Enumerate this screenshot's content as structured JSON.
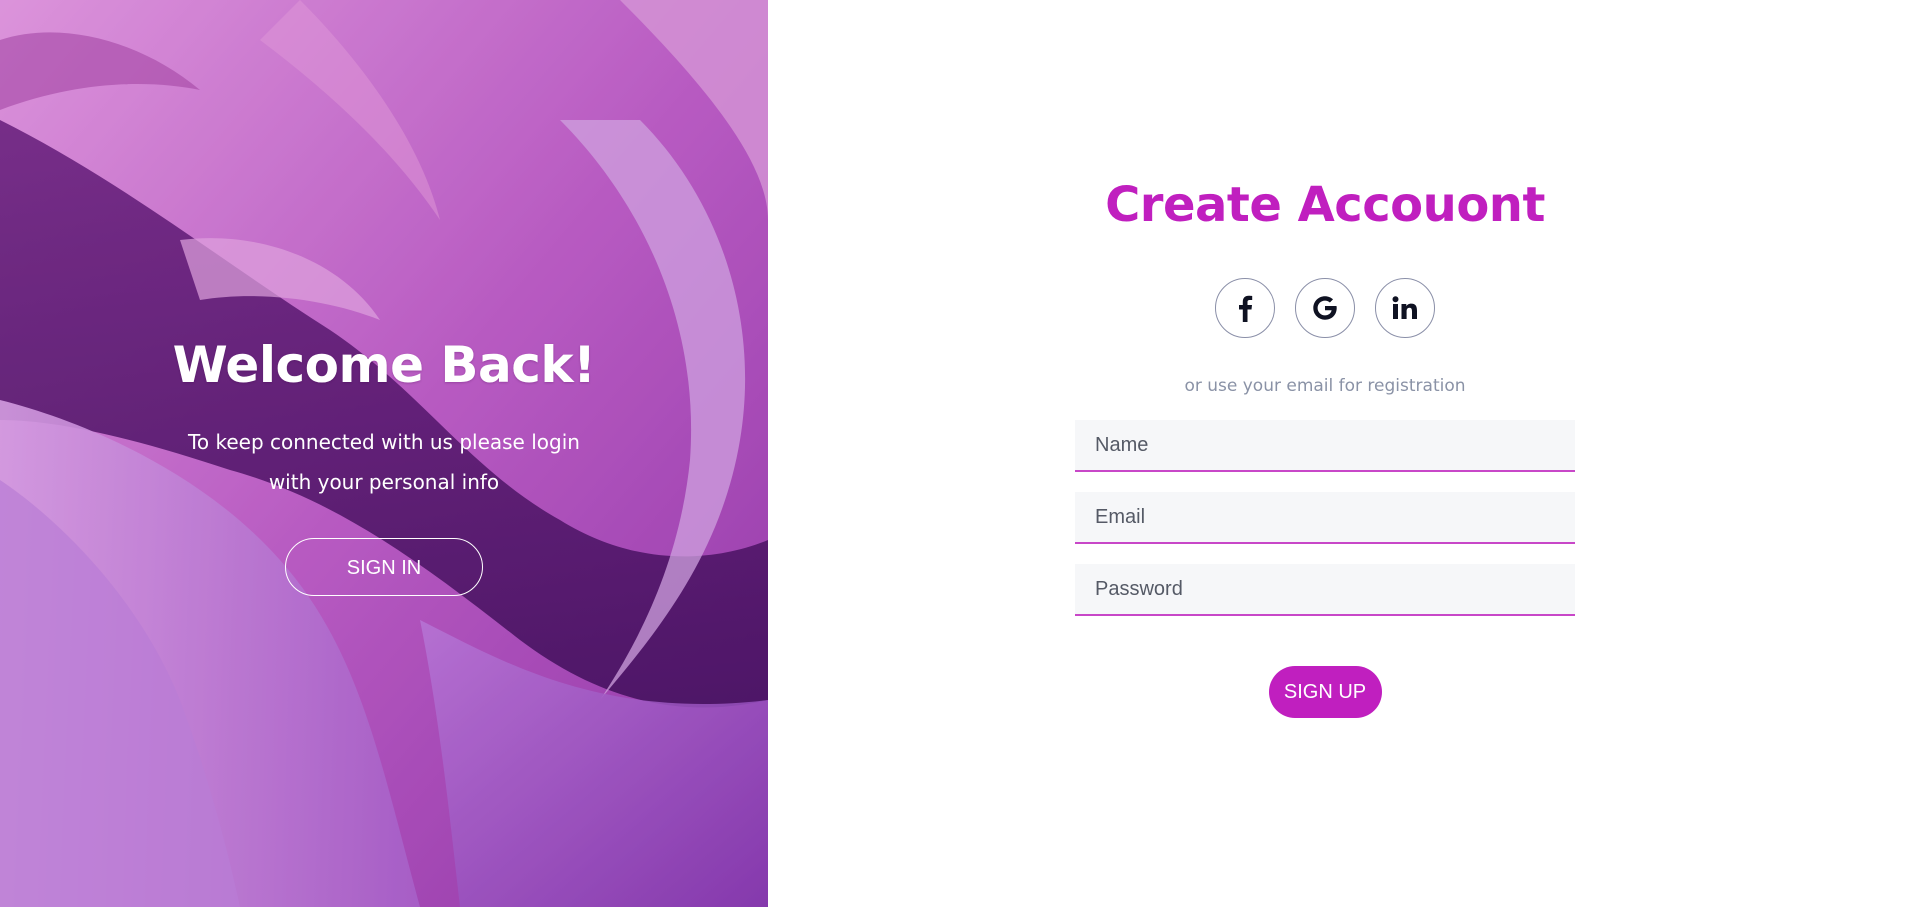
{
  "left_panel": {
    "title": "Welcome Back!",
    "message": "To keep connected with us please login with your personal info",
    "signin_label": "SIGN IN"
  },
  "right_panel": {
    "title": "Create Accouont",
    "social": [
      {
        "icon": "facebook-icon",
        "glyph": "f"
      },
      {
        "icon": "google-icon",
        "glyph": "G"
      },
      {
        "icon": "linkedin-icon",
        "glyph": "in"
      }
    ],
    "divider_text": "or use your email for registration",
    "fields": {
      "name_placeholder": "Name",
      "email_placeholder": "Email",
      "password_placeholder": "Password"
    },
    "signup_label": "SIGN UP"
  },
  "colors": {
    "accent": "#c01fbf",
    "field_underline": "#c847c8",
    "field_bg": "#f6f7f9",
    "muted_text": "#8a92a6"
  }
}
